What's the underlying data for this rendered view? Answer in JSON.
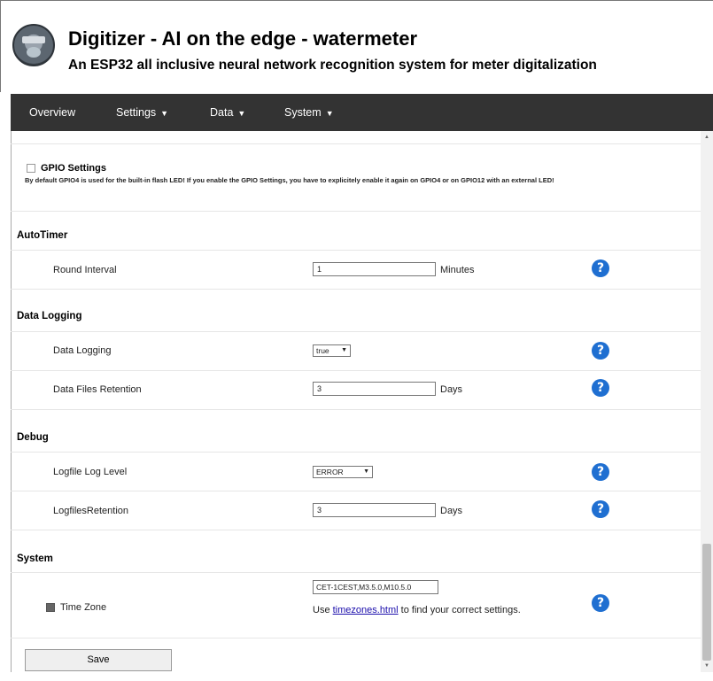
{
  "header": {
    "title": "Digitizer - AI on the edge - watermeter",
    "subtitle": "An ESP32 all inclusive neural network recognition system for meter digitalization",
    "logo_icon": "watermeter-logo-icon"
  },
  "nav": {
    "items": [
      {
        "label": "Overview",
        "dropdown": false
      },
      {
        "label": "Settings",
        "dropdown": true
      },
      {
        "label": "Data",
        "dropdown": true
      },
      {
        "label": "System",
        "dropdown": true
      }
    ]
  },
  "gpio": {
    "label": "GPIO Settings",
    "checked": false,
    "note": "By default GPIO4 is used for the built-in flash LED! If you enable the GPIO Settings, you have to explicitely enable it again on GPIO4 or on GPIO12 with an external LED!"
  },
  "sections": {
    "autotimer": {
      "title": "AutoTimer",
      "round_interval": {
        "label": "Round Interval",
        "value": "1",
        "unit": "Minutes"
      }
    },
    "datalogging": {
      "title": "Data Logging",
      "data_logging": {
        "label": "Data Logging",
        "value": "true"
      },
      "retention": {
        "label": "Data Files Retention",
        "value": "3",
        "unit": "Days"
      }
    },
    "debug": {
      "title": "Debug",
      "log_level": {
        "label": "Logfile Log Level",
        "value": "ERROR"
      },
      "logfiles_retention": {
        "label": "LogfilesRetention",
        "value": "3",
        "unit": "Days"
      }
    },
    "system": {
      "title": "System",
      "timezone": {
        "label": "Time Zone",
        "checked": true,
        "value": "CET-1CEST,M3.5.0,M10.5.0",
        "hint_prefix": "Use",
        "hint_link": "timezones.html",
        "hint_suffix": "to find your correct settings."
      }
    }
  },
  "help_icon": "?",
  "save_label": "Save",
  "colors": {
    "navbar": "#333333",
    "help": "#1f6fd1",
    "link": "#1a0dab"
  }
}
